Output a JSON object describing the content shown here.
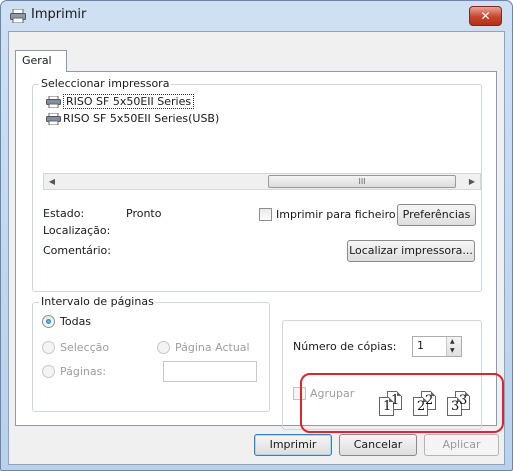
{
  "window": {
    "title": "Imprimir",
    "close_label": "✕"
  },
  "tabs": [
    {
      "label": "Geral"
    }
  ],
  "printer_group": {
    "label": "Seleccionar impressora",
    "printers": [
      {
        "name": "RISO SF 5x50EII Series",
        "selected": true
      },
      {
        "name": "RISO SF 5x50EII Series(USB)",
        "selected": false
      }
    ],
    "scroll_grip": "III",
    "status_label": "Estado:",
    "status_value": "Pronto",
    "location_label": "Localização:",
    "comment_label": "Comentário:",
    "print_to_file_label": "Imprimir para ficheiro",
    "preferences_button": "Preferências",
    "find_printer_button": "Localizar impressora..."
  },
  "page_range_group": {
    "label": "Intervalo de páginas",
    "options": {
      "all": "Todas",
      "selection": "Selecção",
      "current_page": "Página Actual",
      "pages": "Páginas:"
    },
    "selected": "all",
    "pages_value": ""
  },
  "copies": {
    "label": "Número de cópias:",
    "value": "1",
    "collate_label": "Agrupar",
    "collate_checked": false,
    "collate_pages": [
      "1",
      "1",
      "2",
      "2",
      "3",
      "3"
    ]
  },
  "footer": {
    "print_button": "Imprimir",
    "cancel_button": "Cancelar",
    "apply_button": "Aplicar"
  },
  "colors": {
    "highlight": "#e0242a",
    "titlebar": "#c4d8ef",
    "close": "#c4462f"
  }
}
